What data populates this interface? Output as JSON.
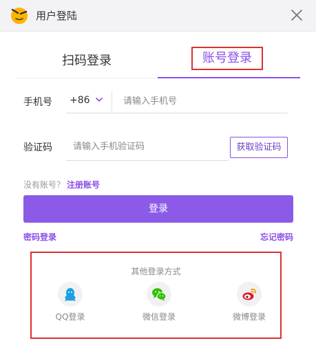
{
  "window": {
    "title": "用户登陆"
  },
  "tabs": {
    "scan": "扫码登录",
    "account": "账号登录"
  },
  "form": {
    "phone_label": "手机号",
    "country_code": "+86",
    "phone_placeholder": "请输入手机号",
    "code_label": "验证码",
    "code_placeholder": "请输入手机验证码",
    "get_code_button": "获取验证码"
  },
  "register": {
    "prompt": "没有账号？",
    "link": "注册账号"
  },
  "login_button": "登录",
  "links": {
    "password_login": "密码登录",
    "forgot_password": "忘记密码"
  },
  "other_login": {
    "title": "其他登录方式",
    "options": [
      {
        "label": "QQ登录",
        "icon": "qq-icon"
      },
      {
        "label": "微信登录",
        "icon": "wechat-icon"
      },
      {
        "label": "微博登录",
        "icon": "weibo-icon"
      }
    ]
  },
  "colors": {
    "accent": "#8a4ee8",
    "login_button": "#8b5be8",
    "highlight_border": "#de2f2f",
    "qq_blue": "#1ba0e1",
    "wechat_green": "#2dc100",
    "weibo_red": "#e6162d"
  }
}
